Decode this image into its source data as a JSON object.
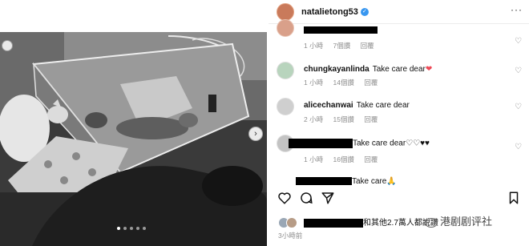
{
  "post": {
    "username": "natalietong53",
    "time_ago": "3小時前",
    "likes_suffix": "和其他2.7萬人都說讚"
  },
  "carousel": {
    "dot_count": 5,
    "active_dot": 0,
    "next_glyph": "›"
  },
  "comments": [
    {
      "username": "",
      "text": "",
      "time": "1 小時",
      "likes": "7個讚",
      "reply": "回覆"
    },
    {
      "username": "chungkayanlinda",
      "text": "Take care dear",
      "emoji": "❤",
      "time": "1 小時",
      "likes": "14個讚",
      "reply": "回覆"
    },
    {
      "username": "alicechanwai",
      "text": "Take care dear",
      "time": "2 小時",
      "likes": "15個讚",
      "reply": "回覆"
    },
    {
      "username": "",
      "text": "Take care dear",
      "emoji": "♡♡♥♥",
      "time": "1 小時",
      "likes": "16個讚",
      "reply": "回覆"
    },
    {
      "username": "",
      "text": "Take care",
      "emoji": "🙏",
      "time": "",
      "likes": "",
      "reply": ""
    }
  ],
  "watermark": {
    "text": "港剧剧评社"
  },
  "icons": {
    "verified": "verified-badge-icon",
    "more": "more-options-icon",
    "like": "heart-icon",
    "comment": "comment-bubble-icon",
    "share": "paper-plane-icon",
    "save": "bookmark-icon"
  },
  "colors": {
    "verified": "#3897f0",
    "heart": "#ed4956",
    "meta": "#8e8e8e"
  }
}
